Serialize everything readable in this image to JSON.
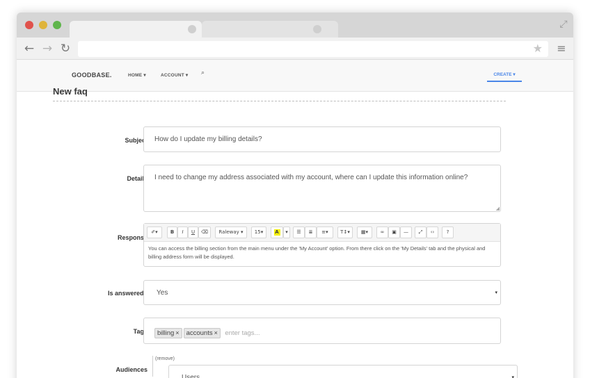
{
  "browser": {
    "title_tabs": [
      "",
      ""
    ],
    "url": "",
    "icons": {
      "back": "arrow-left-icon",
      "forward": "arrow-right-icon",
      "reload": "reload-icon",
      "bookmark": "star-icon",
      "menu": "hamburger-menu-icon",
      "expand": "expand-icon"
    },
    "colors": {
      "close": "#e0524c",
      "minimize": "#dfb43b",
      "maximize": "#5fb54b"
    }
  },
  "navbar": {
    "brand": "GOODBASE.",
    "home": "HOME",
    "account": "ACCOUNT",
    "create": "CREATE",
    "accent": "#4a86e8"
  },
  "page": {
    "title": "New faq"
  },
  "form": {
    "subject": {
      "label": "Subject",
      "value": "How do I update my billing details?"
    },
    "details": {
      "label": "Details",
      "value": "I need to change my address associated with my account, where can I update this information online?"
    },
    "response": {
      "label": "Response",
      "toolbar": {
        "font": "Raleway",
        "size": "15"
      },
      "value": "You can access the billing section from the main menu under the 'My Account' option. From there click on the 'My Details' tab and the physical and billing address form will be displayed."
    },
    "is_answered": {
      "label": "Is answered?",
      "value": "Yes"
    },
    "tags": {
      "label": "Tags",
      "items": [
        "billing",
        "accounts"
      ],
      "placeholder": "enter tags..."
    },
    "audiences": {
      "label": "Audiences",
      "remove": "(remove)",
      "value": "Users"
    }
  }
}
